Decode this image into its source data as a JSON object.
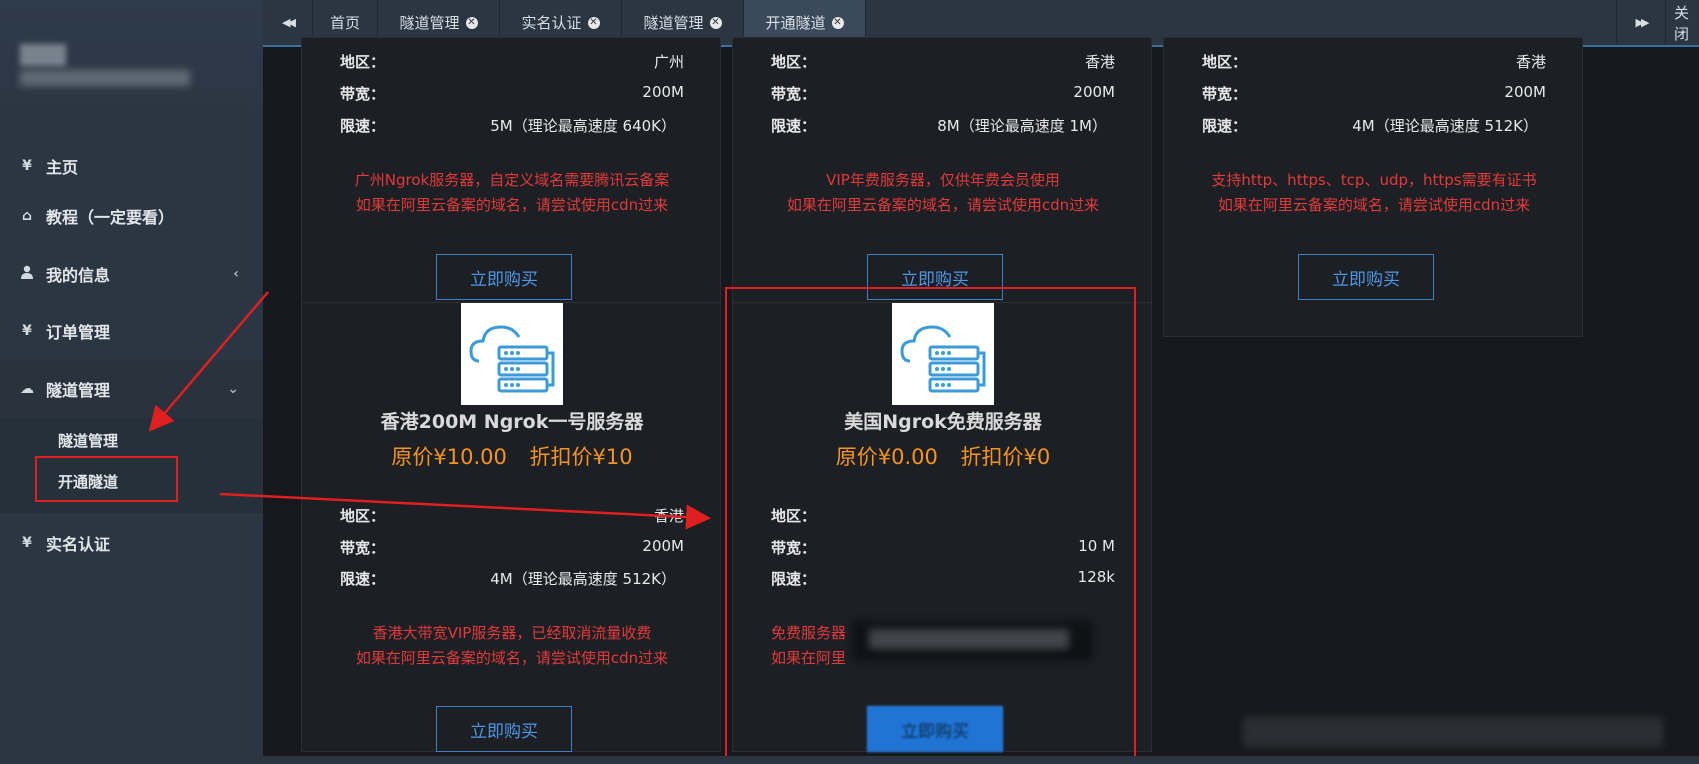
{
  "sidebar": {
    "items": [
      {
        "icon": "yen-icon",
        "glyph": "¥",
        "label": "主页"
      },
      {
        "icon": "home-icon",
        "glyph": "⌂",
        "label": "教程（一定要看）"
      },
      {
        "icon": "user-icon",
        "glyph": "👤",
        "label": "我的信息",
        "caret": "‹"
      },
      {
        "icon": "yen-icon",
        "glyph": "¥",
        "label": "订单管理"
      },
      {
        "icon": "cloud-icon",
        "glyph": "☁",
        "label": "隧道管理",
        "caret": "⌄"
      },
      {
        "icon": "yen-icon",
        "glyph": "¥",
        "label": "实名认证"
      }
    ],
    "submenu": [
      "隧道管理",
      "开通隧道"
    ]
  },
  "tabbar": {
    "prev": "◀◀",
    "next": "▶▶",
    "close_label": "关闭",
    "tabs": [
      {
        "label": "首页"
      },
      {
        "label": "隧道管理",
        "closable": true
      },
      {
        "label": "实名认证",
        "closable": true
      },
      {
        "label": "隧道管理",
        "closable": true
      },
      {
        "label": "开通隧道",
        "closable": true,
        "active": true
      }
    ]
  },
  "labels": {
    "region": "地区：",
    "bandwidth": "带宽：",
    "speed": "限速：",
    "buy": "立即购买"
  },
  "cards": [
    {
      "region": "广州",
      "bandwidth": "200M",
      "speed": "5M（理论最高速度 640K）",
      "desc1": "广州Ngrok服务器，自定义域名需要腾讯云备案",
      "desc2": "如果在阿里云备案的域名，请尝试使用cdn过来"
    },
    {
      "region": "香港",
      "bandwidth": "200M",
      "speed": "8M（理论最高速度 1M）",
      "desc1": "VIP年费服务器，仅供年费会员使用",
      "desc2": "如果在阿里云备案的域名，请尝试使用cdn过来"
    },
    {
      "region": "香港",
      "bandwidth": "200M",
      "speed": "4M（理论最高速度 512K）",
      "desc1": "支持http、https、tcp、udp，https需要有证书",
      "desc2": "如果在阿里云备案的域名，请尝试使用cdn过来"
    },
    {
      "title": "香港200M Ngrok一号服务器",
      "orig_price": "原价¥10.00",
      "disc_price": "折扣价¥10",
      "region": "香港",
      "bandwidth": "200M",
      "speed": "4M（理论最高速度 512K）",
      "desc1": "香港大带宽VIP服务器，已经取消流量收费",
      "desc2": "如果在阿里云备案的域名，请尝试使用cdn过来"
    },
    {
      "title": "美国Ngrok免费服务器",
      "orig_price": "原价¥0.00",
      "disc_price": "折扣价¥0",
      "region": "",
      "bandwidth": "10 M",
      "speed": "128k",
      "desc1": "免费服务器",
      "desc2": "如果在阿里"
    }
  ],
  "colors": {
    "accent_red": "#e02020",
    "price_orange": "#f7941d",
    "link_blue": "#4d97e6",
    "sidebar_bg": "#2b3643"
  }
}
